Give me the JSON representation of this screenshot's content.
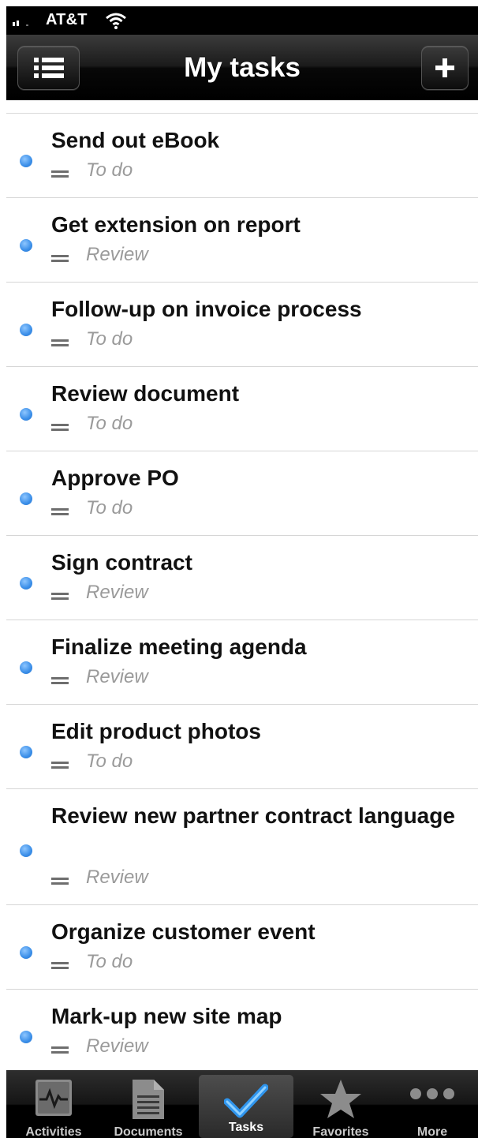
{
  "status_bar": {
    "carrier": "AT&T"
  },
  "nav": {
    "title": "My tasks"
  },
  "tasks": [
    {
      "title": "Send out eBook",
      "status": "To do"
    },
    {
      "title": "Get extension on report",
      "status": "Review"
    },
    {
      "title": "Follow-up on invoice process",
      "status": "To do"
    },
    {
      "title": "Review document",
      "status": "To do"
    },
    {
      "title": "Approve PO",
      "status": "To do"
    },
    {
      "title": "Sign contract",
      "status": "Review"
    },
    {
      "title": "Finalize meeting agenda",
      "status": "Review"
    },
    {
      "title": "Edit product photos",
      "status": "To do"
    },
    {
      "title": "Review new partner contract language",
      "status": "Review"
    },
    {
      "title": "Organize customer event",
      "status": "To do"
    },
    {
      "title": "Mark-up new site map",
      "status": "Review"
    }
  ],
  "tabbar": {
    "tabs": [
      {
        "label": "Activities",
        "icon": "activity-icon"
      },
      {
        "label": "Documents",
        "icon": "document-icon"
      },
      {
        "label": "Tasks",
        "icon": "checkmark-icon",
        "active": true
      },
      {
        "label": "Favorites",
        "icon": "star-icon"
      },
      {
        "label": "More",
        "icon": "more-dots-icon"
      }
    ]
  },
  "colors": {
    "unread_dot": "#3a8ee8",
    "bar": "#000000",
    "status_text": "#9a9a9a"
  }
}
